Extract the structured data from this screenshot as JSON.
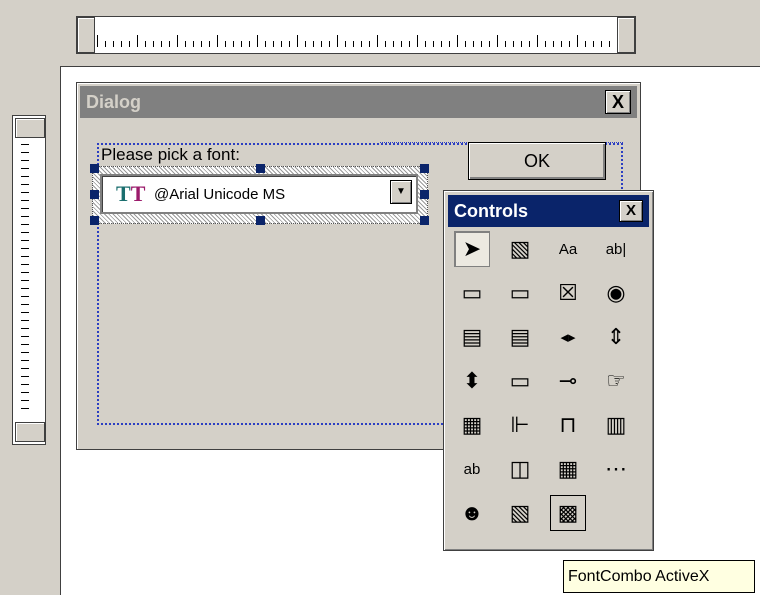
{
  "dialog": {
    "title": "Dialog",
    "close_label": "X"
  },
  "form": {
    "prompt_label": "Please pick a font:",
    "font_combo_value": "@Arial Unicode MS",
    "font_icon_glyph": "TT",
    "ok_label": "OK"
  },
  "toolbox": {
    "title": "Controls",
    "close_label": "X",
    "tools": [
      {
        "name": "select-pointer-icon",
        "glyph": "➤"
      },
      {
        "name": "image-icon",
        "glyph": "▧"
      },
      {
        "name": "label-icon",
        "glyph": "Aa"
      },
      {
        "name": "textbox-icon",
        "glyph": "ab|"
      },
      {
        "name": "frame-icon",
        "glyph": "▭"
      },
      {
        "name": "command-button-icon",
        "glyph": "▭"
      },
      {
        "name": "checkbox-icon",
        "glyph": "☒"
      },
      {
        "name": "option-button-icon",
        "glyph": "◉"
      },
      {
        "name": "listbox-icon",
        "glyph": "▤"
      },
      {
        "name": "combobox-icon",
        "glyph": "▤"
      },
      {
        "name": "hscroll-icon",
        "glyph": "◂▸"
      },
      {
        "name": "vscroll-icon",
        "glyph": "⇕"
      },
      {
        "name": "spin-button-icon",
        "glyph": "⬍"
      },
      {
        "name": "progress-bar-icon",
        "glyph": "▭"
      },
      {
        "name": "slider-icon",
        "glyph": "⊸"
      },
      {
        "name": "hyperlink-icon",
        "glyph": "☞"
      },
      {
        "name": "calendar-icon",
        "glyph": "▦"
      },
      {
        "name": "treeview-icon",
        "glyph": "⊩"
      },
      {
        "name": "tabstrip-icon",
        "glyph": "⊓"
      },
      {
        "name": "filmstrip-icon",
        "glyph": "▥"
      },
      {
        "name": "underline-text-icon",
        "glyph": "ab"
      },
      {
        "name": "image-combo-icon",
        "glyph": "◫"
      },
      {
        "name": "grid-icon",
        "glyph": "▦"
      },
      {
        "name": "ellipsis-icon",
        "glyph": "⋯"
      },
      {
        "name": "agent-icon",
        "glyph": "☻"
      },
      {
        "name": "picture-icon",
        "glyph": "▧"
      },
      {
        "name": "fontcombo-icon",
        "glyph": "▩"
      }
    ]
  },
  "tooltip": {
    "text": "FontCombo ActiveX"
  }
}
